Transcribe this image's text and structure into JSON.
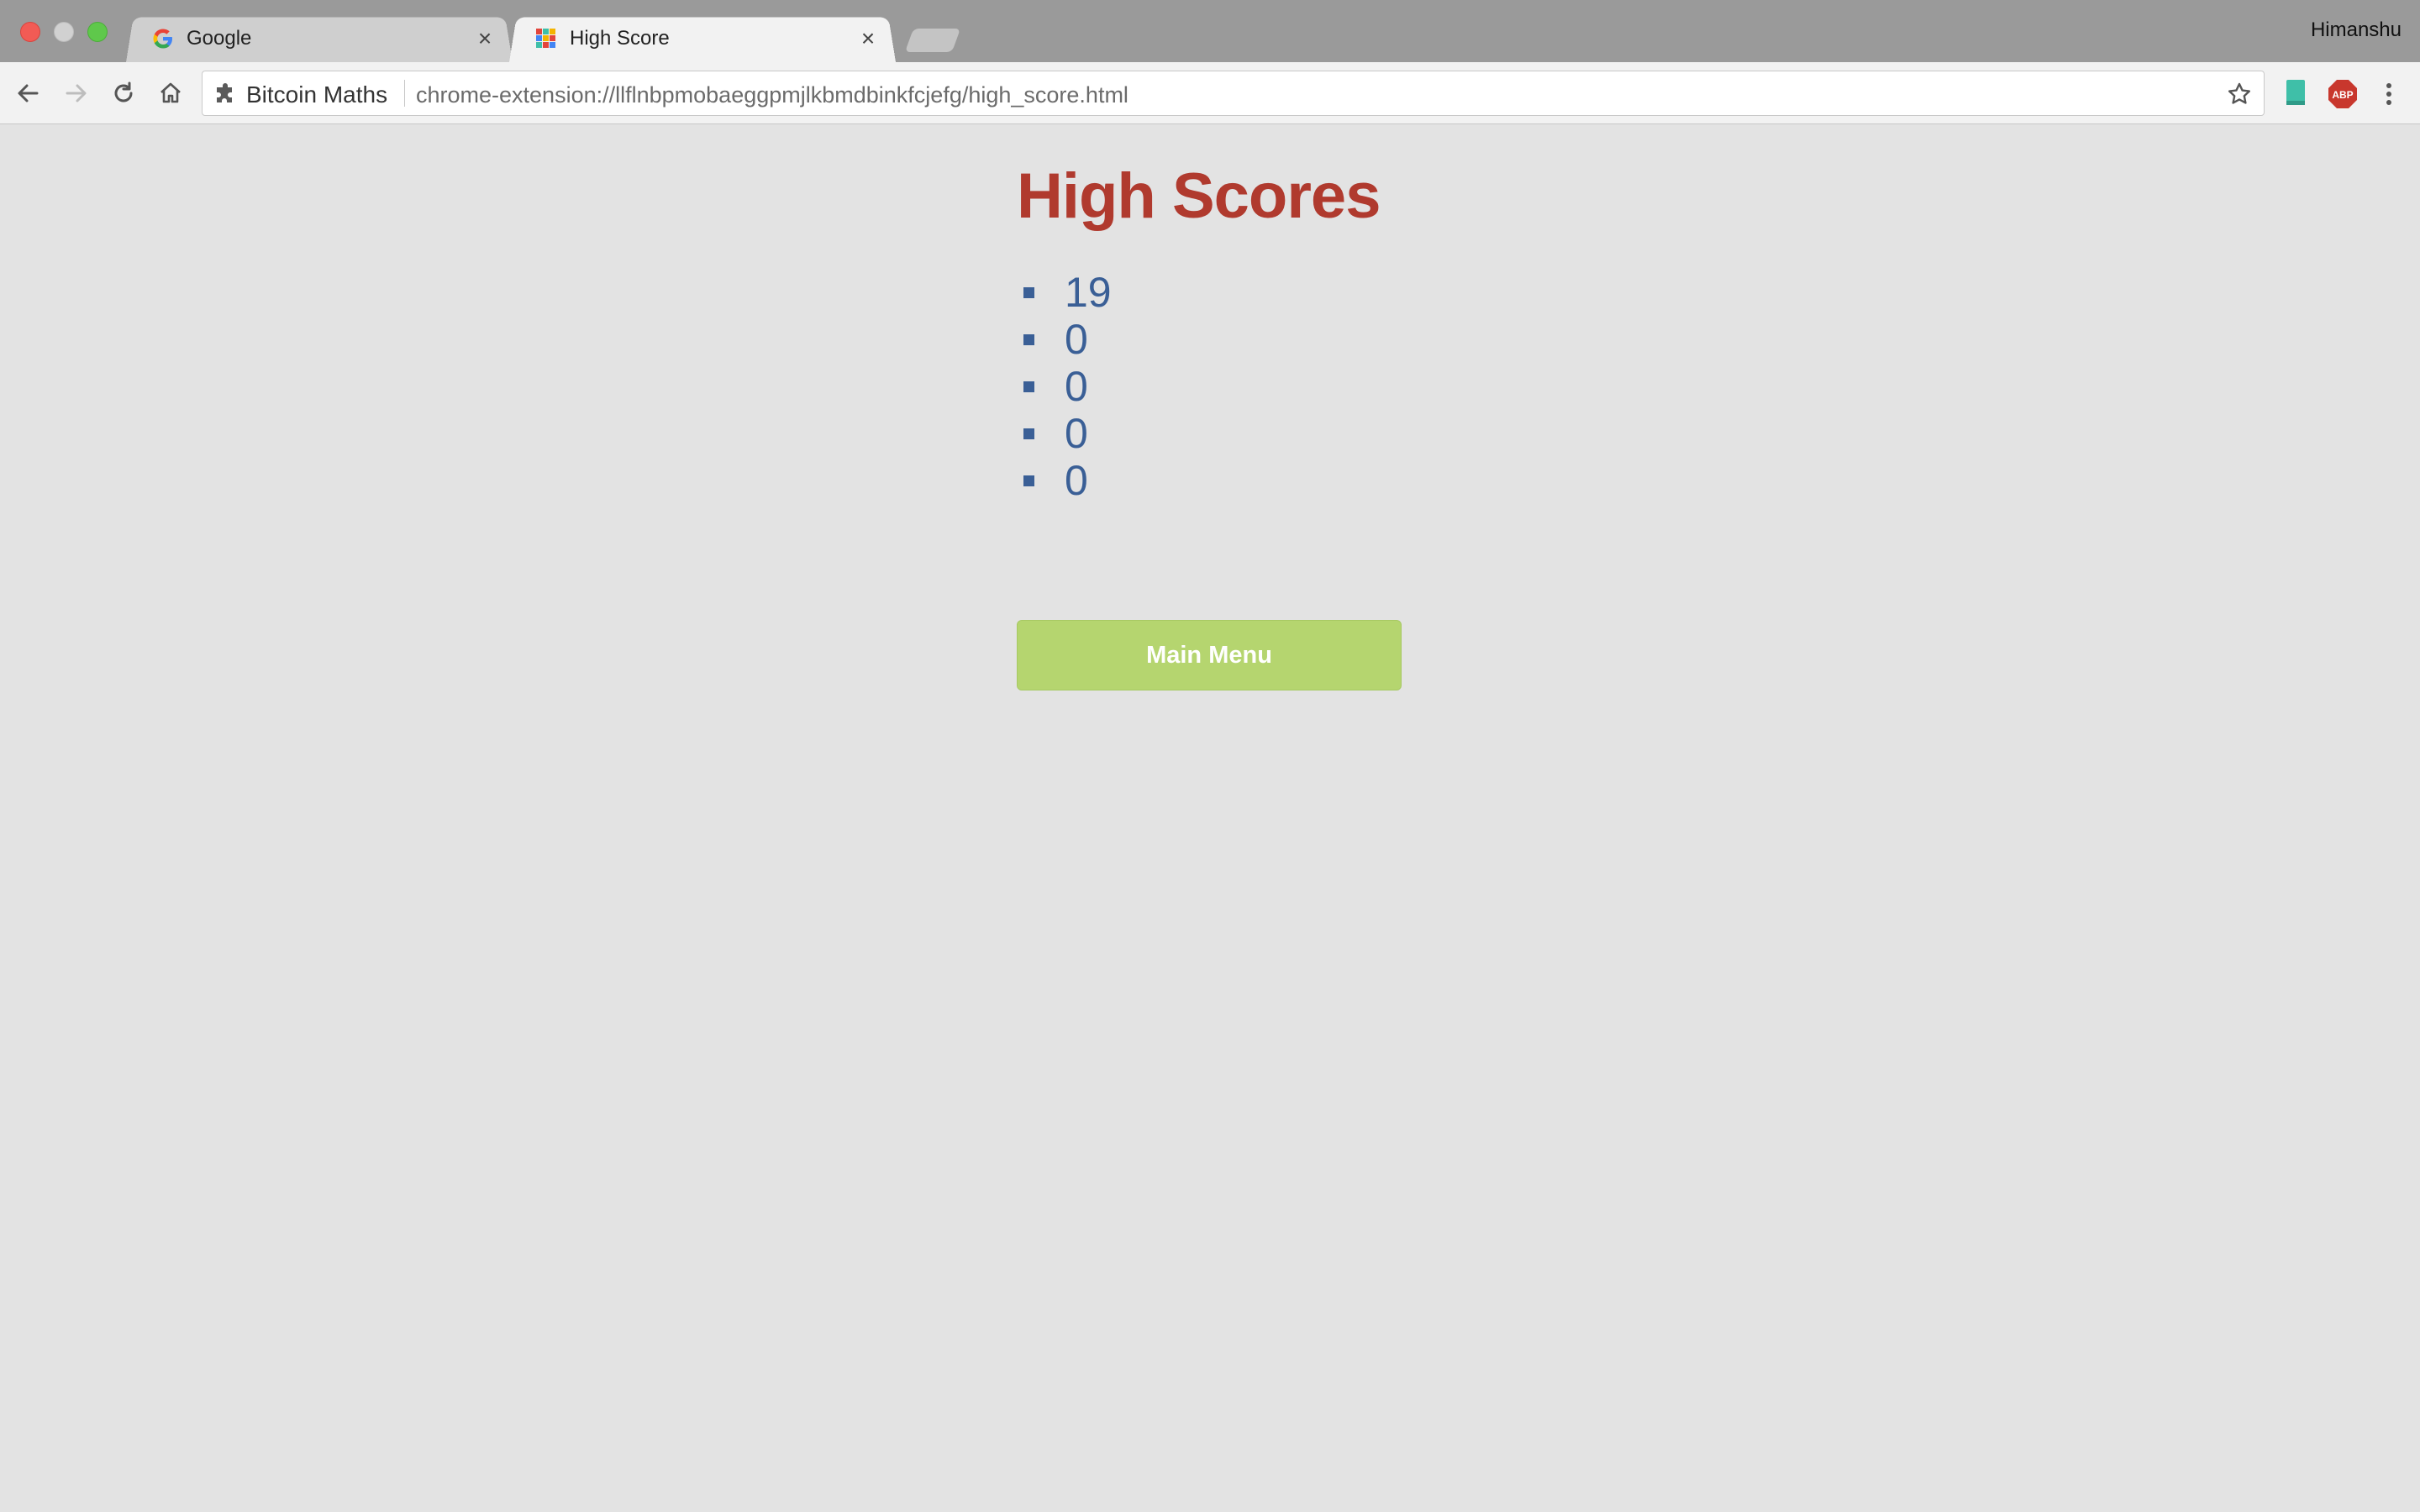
{
  "browser": {
    "tabs": [
      {
        "title": "Google",
        "favicon": "google-g-icon",
        "active": false
      },
      {
        "title": "High Score",
        "favicon": "puzzle-grid-icon",
        "active": true
      }
    ],
    "tab_close_glyph": "×",
    "profile_name": "Himanshu",
    "omnibox": {
      "site_name": "Bitcoin Maths",
      "url": "chrome-extension://llflnbpmobaeggpmjlkbmdbinkfcjefg/high_score.html"
    },
    "extensions": [
      "bookmark-extension-icon",
      "adblock-plus-icon"
    ],
    "colors": {
      "abp_red": "#c8372d",
      "bookmark_teal": "#3fbfa8"
    }
  },
  "page": {
    "heading": "High Scores",
    "scores": [
      "19",
      "0",
      "0",
      "0",
      "0"
    ],
    "main_menu_label": "Main Menu",
    "colors": {
      "heading": "#b03a2e",
      "score_text": "#3a5f96",
      "button_bg": "#b5d56f",
      "background": "#e3e3e3"
    }
  }
}
